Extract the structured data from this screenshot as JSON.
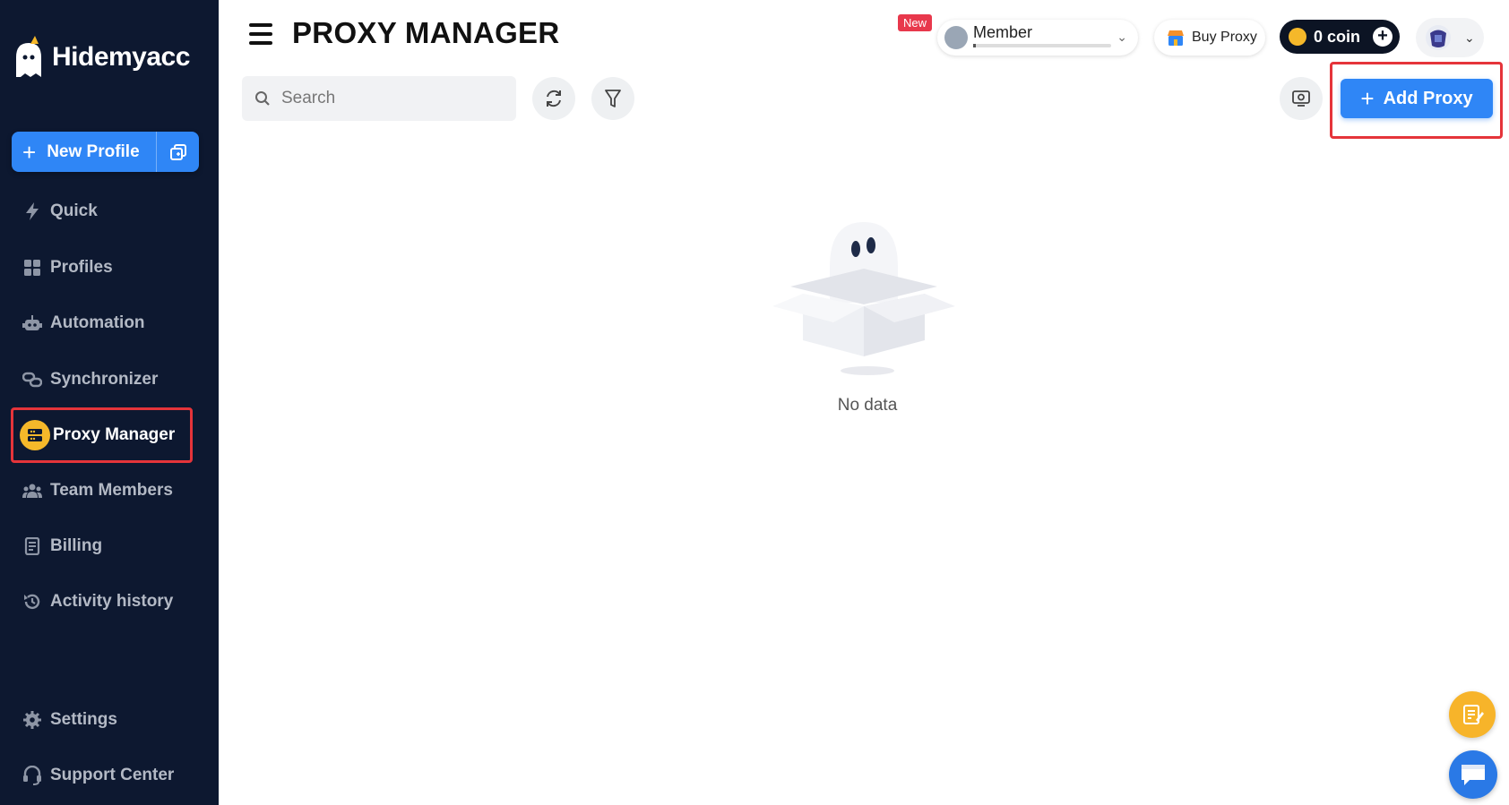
{
  "app": {
    "brand": "Hidemyacc",
    "page_title": "PROXY MANAGER"
  },
  "sidebar": {
    "new_profile_label": "New Profile",
    "items": [
      {
        "label": "Quick",
        "icon": "lightning-icon"
      },
      {
        "label": "Profiles",
        "icon": "grid-icon"
      },
      {
        "label": "Automation",
        "icon": "robot-icon"
      },
      {
        "label": "Synchronizer",
        "icon": "sync-link-icon"
      },
      {
        "label": "Proxy Manager",
        "icon": "proxy-server-icon",
        "active": true
      },
      {
        "label": "Team Members",
        "icon": "team-icon"
      },
      {
        "label": "Billing",
        "icon": "billing-icon"
      },
      {
        "label": "Activity history",
        "icon": "history-icon"
      },
      {
        "label": "Settings",
        "icon": "gear-icon"
      },
      {
        "label": "Support Center",
        "icon": "support-icon"
      }
    ]
  },
  "header": {
    "new_badge": "New",
    "member_label": "Member",
    "buy_proxy_label": "Buy Proxy",
    "coin_label": "0 coin"
  },
  "toolbar": {
    "search_placeholder": "Search",
    "add_proxy_label": "Add Proxy"
  },
  "main": {
    "empty_text": "No data"
  },
  "colors": {
    "sidebar_bg": "#0d1830",
    "accent": "#2f86f6",
    "highlight": "#e5343a",
    "active_icon": "#f5b82a"
  }
}
